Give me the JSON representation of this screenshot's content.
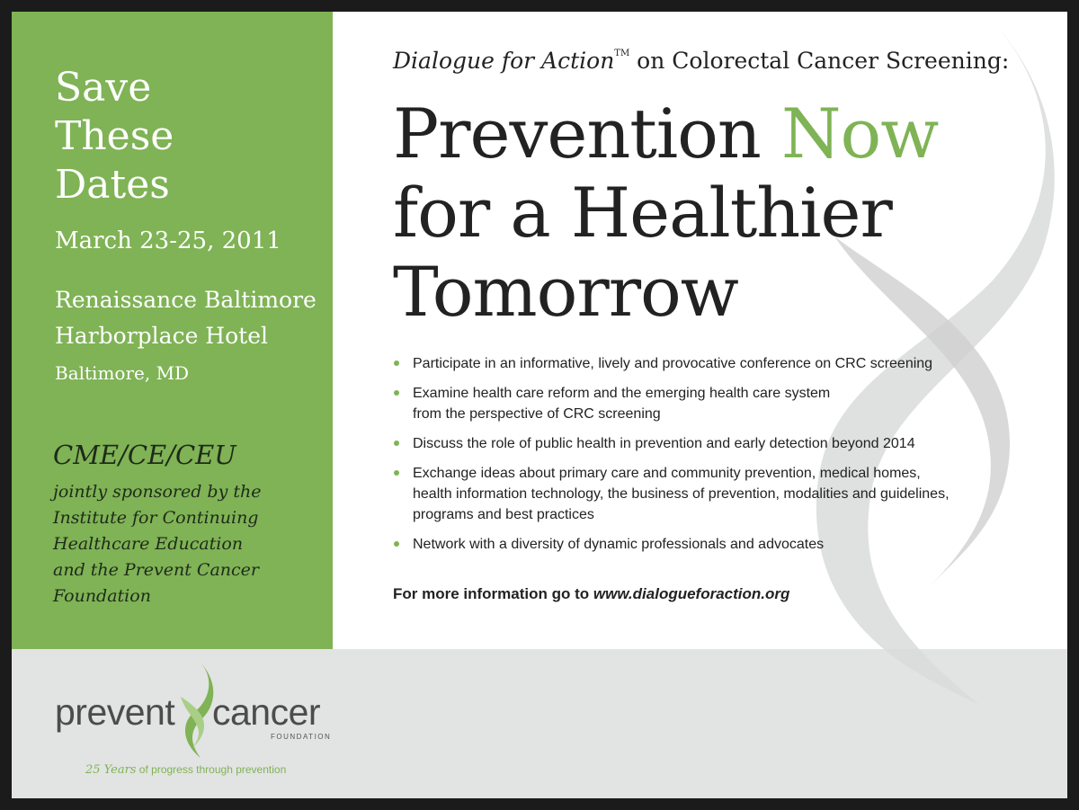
{
  "sidebar": {
    "save_lines": [
      "Save",
      "These",
      "Dates"
    ],
    "dates": "March 23-25, 2011",
    "venue_line1": "Renaissance Baltimore",
    "venue_line2": "Harborplace Hotel",
    "venue_line3": "Baltimore, MD",
    "cme": "CME/CE/CEU",
    "sponsor_lines": [
      "jointly sponsored by the",
      "Institute for Continuing",
      "Healthcare Education",
      "and the Prevent Cancer",
      "Foundation"
    ]
  },
  "header": {
    "subtitle_italic": "Dialogue for Action",
    "tm": "TM",
    "subtitle_rest": " on Colorectal Cancer Screening:",
    "headline_line1_a": "Prevention ",
    "headline_line1_b": "Now",
    "headline_line2": "for a Healthier",
    "headline_line3": "Tomorrow"
  },
  "bullets": [
    [
      "Participate in an informative, lively and provocative conference on CRC screening"
    ],
    [
      "Examine health care reform and the emerging health care system",
      "from the perspective of CRC screening"
    ],
    [
      "Discuss the role of public health in prevention and early detection beyond 2014"
    ],
    [
      "Exchange ideas about primary care and community prevention, medical homes,",
      "health information technology, the business of prevention, modalities and guidelines,",
      "programs and best practices"
    ],
    [
      "Network with a diversity of dynamic professionals and advocates"
    ]
  ],
  "more_info": {
    "prefix": "For more information go to ",
    "url": "www.dialogueforaction.org"
  },
  "footer": {
    "logo_left": "prevent",
    "logo_right": "cancer",
    "logo_sub": "FOUNDATION",
    "tagline_years": "25 Years",
    "tagline_rest": " of progress through prevention"
  },
  "colors": {
    "accent_green": "#7fb355",
    "footer_gray": "#e2e3e3",
    "border": "#1b1b1b"
  }
}
